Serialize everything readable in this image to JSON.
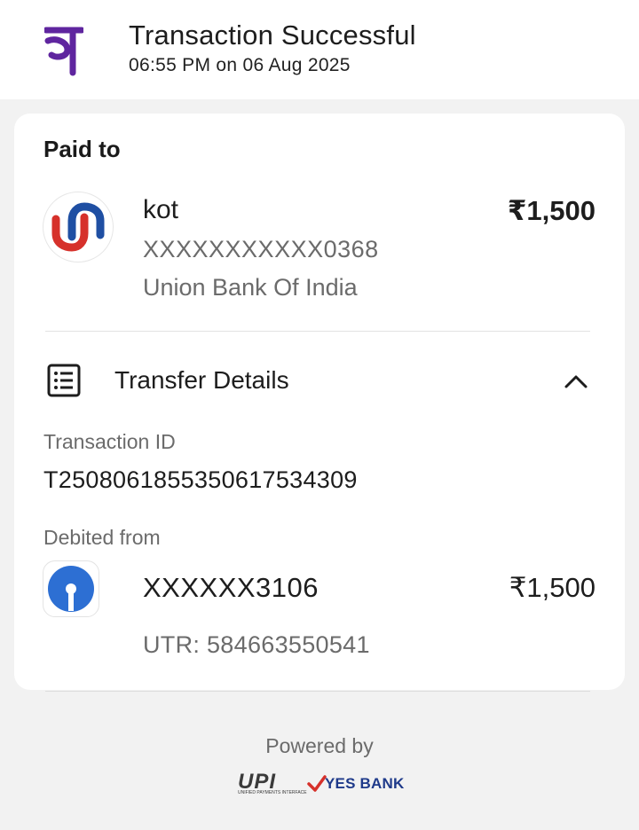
{
  "header": {
    "title": "Transaction Successful",
    "timestamp": "06:55 PM on 06 Aug 2025",
    "logo_icon": "phonepe-logo-icon",
    "brand_color": "#5f259f"
  },
  "paid_to": {
    "label": "Paid to",
    "name": "kot",
    "account": "XXXXXXXXXXX0368",
    "bank": "Union Bank Of India",
    "amount": "₹1,500",
    "logo_icon": "union-bank-logo-icon"
  },
  "transfer_details": {
    "label": "Transfer Details",
    "icon": "list-details-icon",
    "toggle_icon": "chevron-up-icon",
    "transaction_id_label": "Transaction ID",
    "transaction_id": "T2508061855350617534309",
    "debited_from_label": "Debited from",
    "debited_account": "XXXXXX3106",
    "debited_amount": "₹1,500",
    "utr": "UTR: 584663550541",
    "source_logo_icon": "sbi-logo-icon"
  },
  "footer": {
    "powered_by": "Powered by",
    "upi_text": "UPI",
    "upi_subtext": "UNIFIED PAYMENTS INTERFACE",
    "bank_text": "YES BANK"
  }
}
